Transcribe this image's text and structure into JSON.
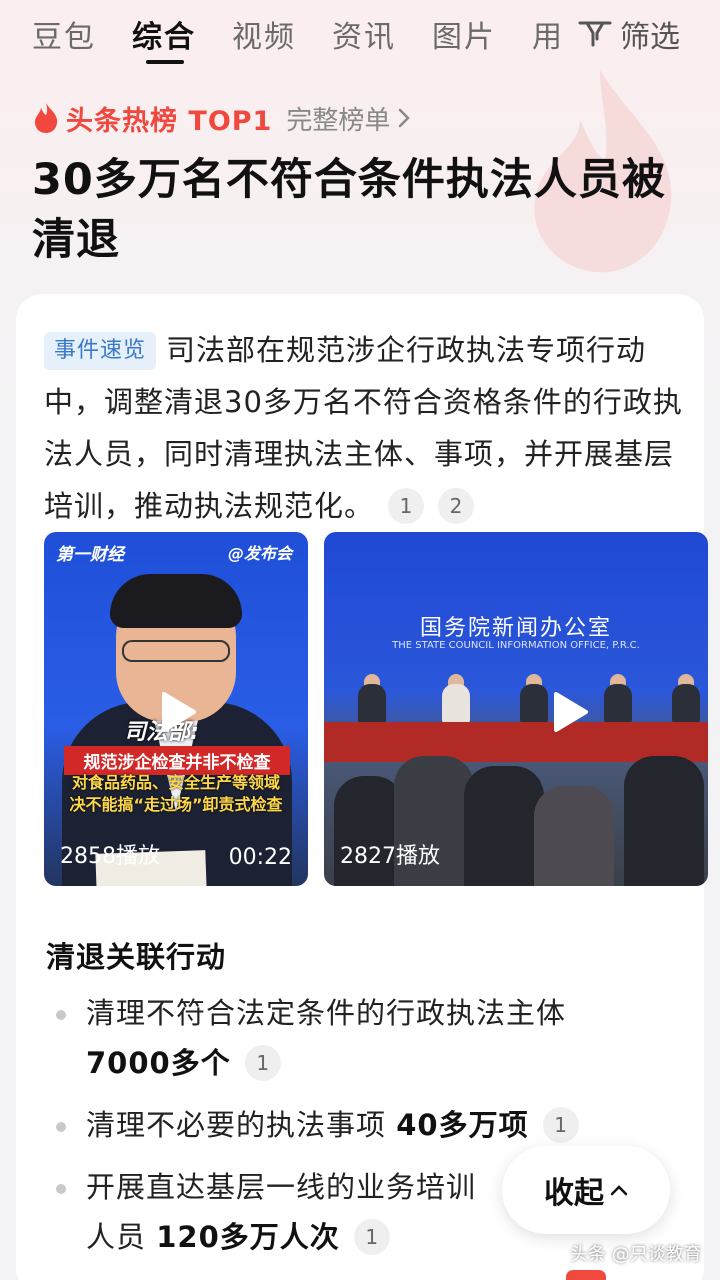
{
  "tabs": [
    {
      "label": "豆包"
    },
    {
      "label": "综合"
    },
    {
      "label": "视频"
    },
    {
      "label": "资讯"
    },
    {
      "label": "图片"
    },
    {
      "label": "用"
    }
  ],
  "active_tab": "综合",
  "filter_label": "筛选",
  "hot": {
    "label": "头条热榜 TOP1",
    "link": "完整榜单"
  },
  "headline": "30多万名不符合条件执法人员被清退",
  "summary": {
    "badge": "事件速览",
    "text": "司法部在规范涉企行政执法专项行动中，调整清退30多万名不符合资格条件的行政执法人员，同时清理执法主体、事项，并开展基层培训，推动执法规范化。",
    "refs": [
      "1",
      "2"
    ]
  },
  "videos": [
    {
      "logo_left": "第一财经",
      "logo_right": "@发布会",
      "caption_title": "司法部:",
      "caption_red": "规范涉企检查并非不检查",
      "caption_yellow_1": "对食品药品、安全生产等领域",
      "caption_yellow_2": "决不能搞“走过场”卸责式检查",
      "plays": "2858播放",
      "duration": "00:22"
    },
    {
      "org_cn": "国务院新闻办公室",
      "org_en": "THE STATE COUNCIL INFORMATION OFFICE, P.R.C.",
      "plays": "2827播放"
    }
  ],
  "section": {
    "title": "清退关联行动",
    "items": [
      {
        "text": "清理不符合法定条件的行政执法主体",
        "bold": "7000多个",
        "ref": "1"
      },
      {
        "text": "清理不必要的执法事项",
        "bold": "40多万项",
        "ref": "1"
      },
      {
        "text": "开展直达基层一线的业务培训人员",
        "bold": "120多万人次",
        "ref": "1"
      }
    ]
  },
  "collapse_label": "收起",
  "watermark": "头条 @只谈教育",
  "colors": {
    "accent_red": "#f0483e",
    "badge_blue": "#3a78c8"
  }
}
